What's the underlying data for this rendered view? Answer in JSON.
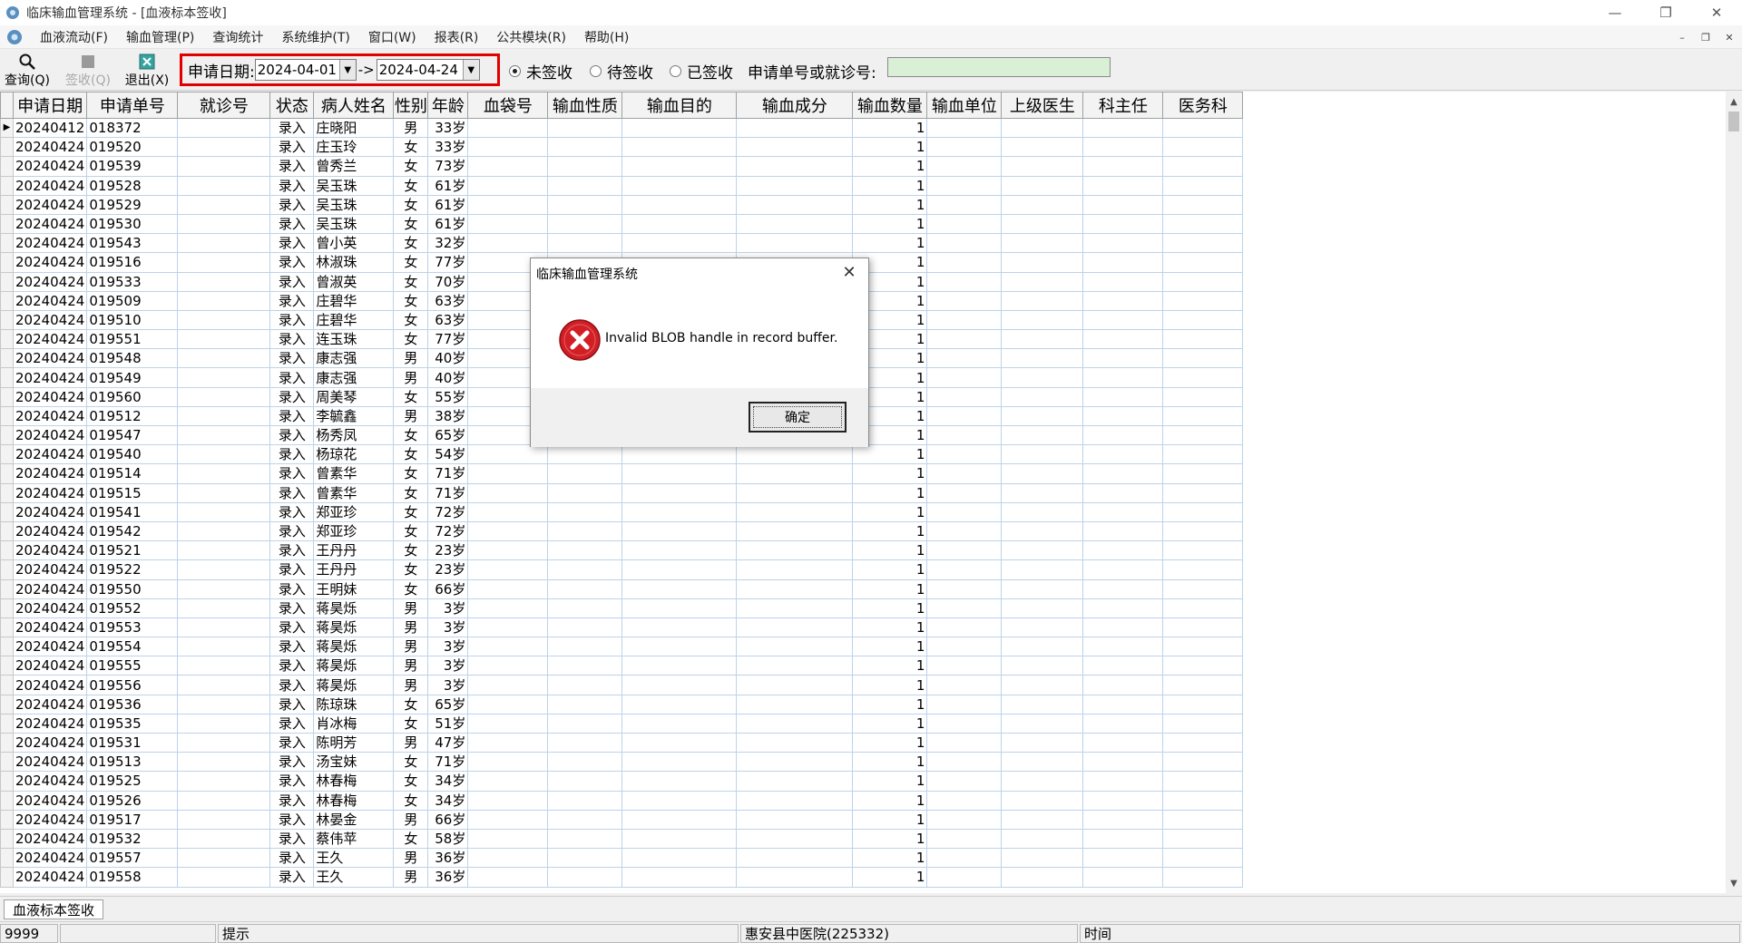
{
  "window": {
    "title": "临床输血管理系统 - [血液标本签收]",
    "controls": {
      "minimize": "—",
      "restore": "❐",
      "close": "✕"
    }
  },
  "menubar": {
    "items": [
      "血液流动(F)",
      "输血管理(P)",
      "查询统计",
      "系统维护(T)",
      "窗口(W)",
      "报表(R)",
      "公共模块(R)",
      "帮助(H)"
    ],
    "mdi": {
      "minimize": "–",
      "restore": "❐",
      "close": "✕"
    }
  },
  "toolbar": {
    "query_label": "查询(Q)",
    "sign_label": "签收(Q)",
    "exit_label": "退出(X)",
    "date_label": "申请日期:",
    "date_from": "2024-04-01",
    "date_to": "2024-04-24",
    "arrow": "->",
    "radio_unsigned": "未签收",
    "radio_pending": "待签收",
    "radio_signed": "已签收",
    "search_label": "申请单号或就诊号:",
    "search_value": ""
  },
  "grid": {
    "columns": [
      "申请日期",
      "申请单号",
      "就诊号",
      "状态",
      "病人姓名",
      "性别",
      "年龄",
      "血袋号",
      "输血性质",
      "输血目的",
      "输血成分",
      "输血数量",
      "输血单位",
      "上级医生",
      "科主任",
      "医务科"
    ],
    "rows": [
      [
        "20240412",
        "018372",
        "",
        "录入",
        "庄晓阳",
        "男",
        "33岁",
        "",
        "",
        "",
        "",
        "1",
        "",
        "",
        "",
        ""
      ],
      [
        "20240424",
        "019520",
        "",
        "录入",
        "庄玉玲",
        "女",
        "33岁",
        "",
        "",
        "",
        "",
        "1",
        "",
        "",
        "",
        ""
      ],
      [
        "20240424",
        "019539",
        "",
        "录入",
        "曾秀兰",
        "女",
        "73岁",
        "",
        "",
        "",
        "",
        "1",
        "",
        "",
        "",
        ""
      ],
      [
        "20240424",
        "019528",
        "",
        "录入",
        "吴玉珠",
        "女",
        "61岁",
        "",
        "",
        "",
        "",
        "1",
        "",
        "",
        "",
        ""
      ],
      [
        "20240424",
        "019529",
        "",
        "录入",
        "吴玉珠",
        "女",
        "61岁",
        "",
        "",
        "",
        "",
        "1",
        "",
        "",
        "",
        ""
      ],
      [
        "20240424",
        "019530",
        "",
        "录入",
        "吴玉珠",
        "女",
        "61岁",
        "",
        "",
        "",
        "",
        "1",
        "",
        "",
        "",
        ""
      ],
      [
        "20240424",
        "019543",
        "",
        "录入",
        "曾小英",
        "女",
        "32岁",
        "",
        "",
        "",
        "",
        "1",
        "",
        "",
        "",
        ""
      ],
      [
        "20240424",
        "019516",
        "",
        "录入",
        "林淑珠",
        "女",
        "77岁",
        "",
        "",
        "",
        "",
        "1",
        "",
        "",
        "",
        ""
      ],
      [
        "20240424",
        "019533",
        "",
        "录入",
        "曾淑英",
        "女",
        "70岁",
        "",
        "",
        "",
        "",
        "1",
        "",
        "",
        "",
        ""
      ],
      [
        "20240424",
        "019509",
        "",
        "录入",
        "庄碧华",
        "女",
        "63岁",
        "",
        "",
        "",
        "",
        "1",
        "",
        "",
        "",
        ""
      ],
      [
        "20240424",
        "019510",
        "",
        "录入",
        "庄碧华",
        "女",
        "63岁",
        "",
        "",
        "",
        "",
        "1",
        "",
        "",
        "",
        ""
      ],
      [
        "20240424",
        "019551",
        "",
        "录入",
        "连玉珠",
        "女",
        "77岁",
        "",
        "",
        "",
        "",
        "1",
        "",
        "",
        "",
        ""
      ],
      [
        "20240424",
        "019548",
        "",
        "录入",
        "康志强",
        "男",
        "40岁",
        "",
        "",
        "",
        "",
        "1",
        "",
        "",
        "",
        ""
      ],
      [
        "20240424",
        "019549",
        "",
        "录入",
        "康志强",
        "男",
        "40岁",
        "",
        "",
        "",
        "",
        "1",
        "",
        "",
        "",
        ""
      ],
      [
        "20240424",
        "019560",
        "",
        "录入",
        "周美琴",
        "女",
        "55岁",
        "",
        "",
        "",
        "",
        "1",
        "",
        "",
        "",
        ""
      ],
      [
        "20240424",
        "019512",
        "",
        "录入",
        "李毓鑫",
        "男",
        "38岁",
        "",
        "",
        "",
        "",
        "1",
        "",
        "",
        "",
        ""
      ],
      [
        "20240424",
        "019547",
        "",
        "录入",
        "杨秀凤",
        "女",
        "65岁",
        "",
        "",
        "",
        "",
        "1",
        "",
        "",
        "",
        ""
      ],
      [
        "20240424",
        "019540",
        "",
        "录入",
        "杨琼花",
        "女",
        "54岁",
        "",
        "",
        "",
        "",
        "1",
        "",
        "",
        "",
        ""
      ],
      [
        "20240424",
        "019514",
        "",
        "录入",
        "曾素华",
        "女",
        "71岁",
        "",
        "",
        "",
        "",
        "1",
        "",
        "",
        "",
        ""
      ],
      [
        "20240424",
        "019515",
        "",
        "录入",
        "曾素华",
        "女",
        "71岁",
        "",
        "",
        "",
        "",
        "1",
        "",
        "",
        "",
        ""
      ],
      [
        "20240424",
        "019541",
        "",
        "录入",
        "郑亚珍",
        "女",
        "72岁",
        "",
        "",
        "",
        "",
        "1",
        "",
        "",
        "",
        ""
      ],
      [
        "20240424",
        "019542",
        "",
        "录入",
        "郑亚珍",
        "女",
        "72岁",
        "",
        "",
        "",
        "",
        "1",
        "",
        "",
        "",
        ""
      ],
      [
        "20240424",
        "019521",
        "",
        "录入",
        "王丹丹",
        "女",
        "23岁",
        "",
        "",
        "",
        "",
        "1",
        "",
        "",
        "",
        ""
      ],
      [
        "20240424",
        "019522",
        "",
        "录入",
        "王丹丹",
        "女",
        "23岁",
        "",
        "",
        "",
        "",
        "1",
        "",
        "",
        "",
        ""
      ],
      [
        "20240424",
        "019550",
        "",
        "录入",
        "王明妹",
        "女",
        "66岁",
        "",
        "",
        "",
        "",
        "1",
        "",
        "",
        "",
        ""
      ],
      [
        "20240424",
        "019552",
        "",
        "录入",
        "蒋昊烁",
        "男",
        "3岁",
        "",
        "",
        "",
        "",
        "1",
        "",
        "",
        "",
        ""
      ],
      [
        "20240424",
        "019553",
        "",
        "录入",
        "蒋昊烁",
        "男",
        "3岁",
        "",
        "",
        "",
        "",
        "1",
        "",
        "",
        "",
        ""
      ],
      [
        "20240424",
        "019554",
        "",
        "录入",
        "蒋昊烁",
        "男",
        "3岁",
        "",
        "",
        "",
        "",
        "1",
        "",
        "",
        "",
        ""
      ],
      [
        "20240424",
        "019555",
        "",
        "录入",
        "蒋昊烁",
        "男",
        "3岁",
        "",
        "",
        "",
        "",
        "1",
        "",
        "",
        "",
        ""
      ],
      [
        "20240424",
        "019556",
        "",
        "录入",
        "蒋昊烁",
        "男",
        "3岁",
        "",
        "",
        "",
        "",
        "1",
        "",
        "",
        "",
        ""
      ],
      [
        "20240424",
        "019536",
        "",
        "录入",
        "陈琼珠",
        "女",
        "65岁",
        "",
        "",
        "",
        "",
        "1",
        "",
        "",
        "",
        ""
      ],
      [
        "20240424",
        "019535",
        "",
        "录入",
        "肖冰梅",
        "女",
        "51岁",
        "",
        "",
        "",
        "",
        "1",
        "",
        "",
        "",
        ""
      ],
      [
        "20240424",
        "019531",
        "",
        "录入",
        "陈明芳",
        "男",
        "47岁",
        "",
        "",
        "",
        "",
        "1",
        "",
        "",
        "",
        ""
      ],
      [
        "20240424",
        "019513",
        "",
        "录入",
        "汤宝妹",
        "女",
        "71岁",
        "",
        "",
        "",
        "",
        "1",
        "",
        "",
        "",
        ""
      ],
      [
        "20240424",
        "019525",
        "",
        "录入",
        "林春梅",
        "女",
        "34岁",
        "",
        "",
        "",
        "",
        "1",
        "",
        "",
        "",
        ""
      ],
      [
        "20240424",
        "019526",
        "",
        "录入",
        "林春梅",
        "女",
        "34岁",
        "",
        "",
        "",
        "",
        "1",
        "",
        "",
        "",
        ""
      ],
      [
        "20240424",
        "019517",
        "",
        "录入",
        "林晏金",
        "男",
        "66岁",
        "",
        "",
        "",
        "",
        "1",
        "",
        "",
        "",
        ""
      ],
      [
        "20240424",
        "019532",
        "",
        "录入",
        "蔡伟苹",
        "女",
        "58岁",
        "",
        "",
        "",
        "",
        "1",
        "",
        "",
        "",
        ""
      ],
      [
        "20240424",
        "019557",
        "",
        "录入",
        "王久",
        "男",
        "36岁",
        "",
        "",
        "",
        "",
        "1",
        "",
        "",
        "",
        ""
      ],
      [
        "20240424",
        "019558",
        "",
        "录入",
        "王久",
        "男",
        "36岁",
        "",
        "",
        "",
        "",
        "1",
        "",
        "",
        "",
        ""
      ]
    ]
  },
  "tabs": [
    "血液标本签收"
  ],
  "statusbar": {
    "user_code": "9999",
    "hint_label": "提示",
    "hospital": "惠安县中医院(225332)",
    "time_label": "时间"
  },
  "dialog": {
    "title": "临床输血管理系统",
    "message": "Invalid BLOB handle in record buffer.",
    "ok_label": "确定",
    "icon": "error-icon"
  },
  "colors": {
    "highlight_border": "#e00000",
    "search_bg": "#d9f0d6",
    "error_red": "#d21f26"
  }
}
